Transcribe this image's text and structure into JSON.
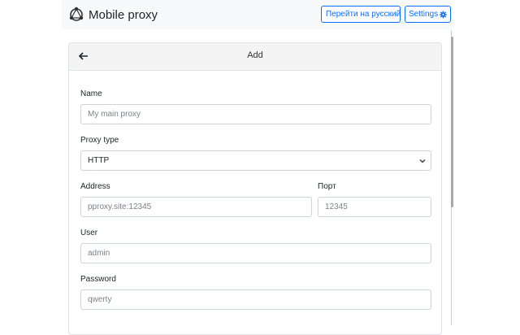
{
  "header": {
    "app_name": "Mobile proxy",
    "lang_button": "Перейти на русский",
    "settings_button": "Settings"
  },
  "card": {
    "title": "Add"
  },
  "form": {
    "name": {
      "label": "Name",
      "placeholder": "My main proxy"
    },
    "proxy_type": {
      "label": "Proxy type",
      "value": "HTTP"
    },
    "address": {
      "label": "Address",
      "placeholder": "pproxy.site:12345"
    },
    "port": {
      "label": "Порт",
      "placeholder": "12345"
    },
    "user": {
      "label": "User",
      "placeholder": "admin"
    },
    "password": {
      "label": "Password",
      "placeholder": "qwerty"
    }
  },
  "colors": {
    "accent": "#0d6efd",
    "header_bg": "#f4f4f4",
    "border": "#ced4da"
  }
}
